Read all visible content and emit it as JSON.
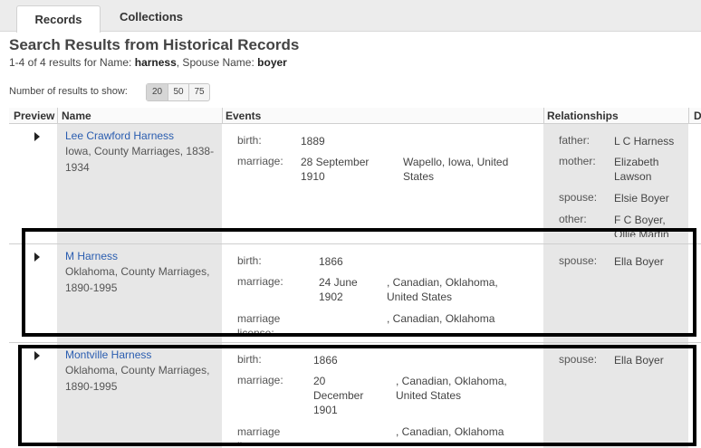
{
  "tabs": [
    {
      "label": "Records"
    },
    {
      "label": "Collections"
    }
  ],
  "page_title": "Search Results from Historical Records",
  "summary": {
    "range": "1-4 of 4 results for Name:",
    "name_value": "harness",
    "spouse_label": ", Spouse Name:",
    "spouse_value": "boyer"
  },
  "results_per_page": {
    "label": "Number of results to show:",
    "options": [
      "20",
      "50",
      "75"
    ],
    "selected": "20"
  },
  "columns": {
    "preview": "Preview",
    "name": "Name",
    "events": "Events",
    "relationships": "Relationships",
    "extra": "D"
  },
  "rows": [
    {
      "name": "Lee Crawford Harness",
      "collection": "Iowa, County Marriages, 1838-1934",
      "events": [
        {
          "label": "birth:",
          "date": "1889",
          "place": ""
        },
        {
          "label": "marriage:",
          "date": "28 September 1910",
          "place": "Wapello, Iowa, United States"
        }
      ],
      "relationships": [
        {
          "label": "father:",
          "value": "L C Harness"
        },
        {
          "label": "mother:",
          "value": "Elizabeth Lawson"
        },
        {
          "label": "spouse:",
          "value": "Elsie Boyer"
        },
        {
          "label": "other:",
          "value": "F C Boyer, Ollie Martin"
        }
      ]
    },
    {
      "name": "M Harness",
      "collection": "Oklahoma, County Marriages, 1890-1995",
      "events": [
        {
          "label": "birth:",
          "date": "1866",
          "place": ""
        },
        {
          "label": "marriage:",
          "date": "24 June 1902",
          "place": ", Canadian, Oklahoma, United States"
        },
        {
          "label": "marriage license:",
          "date": "",
          "place": ", Canadian, Oklahoma"
        }
      ],
      "relationships": [
        {
          "label": "spouse:",
          "value": "Ella Boyer"
        }
      ]
    },
    {
      "name": "Montville Harness",
      "collection": "Oklahoma, County Marriages, 1890-1995",
      "events": [
        {
          "label": "birth:",
          "date": "1866",
          "place": ""
        },
        {
          "label": "marriage:",
          "date": "20 December 1901",
          "place": ", Canadian, Oklahoma, United States"
        },
        {
          "label": "marriage license:",
          "date": "",
          "place": ", Canadian, Oklahoma"
        }
      ],
      "relationships": [
        {
          "label": "spouse:",
          "value": "Ella Boyer"
        }
      ]
    }
  ]
}
